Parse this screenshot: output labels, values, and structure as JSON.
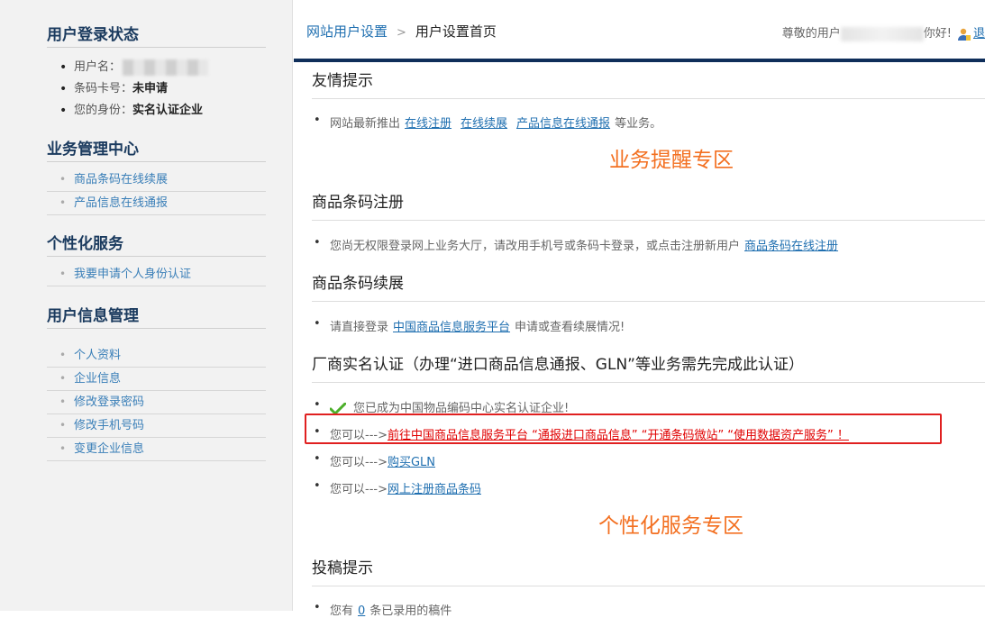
{
  "sidebar": {
    "login_status": {
      "title": "用户登录状态",
      "username_label": "用户名：",
      "barcode_label": "条码卡号：",
      "barcode_value": "未申请",
      "identity_label": "您的身份：",
      "identity_value": "实名认证企业"
    },
    "business": {
      "title": "业务管理中心",
      "items": [
        "商品条码在线续展",
        "产品信息在线通报"
      ]
    },
    "personal": {
      "title": "个性化服务",
      "items": [
        "我要申请个人身份认证"
      ]
    },
    "userinfo": {
      "title": "用户信息管理",
      "items": [
        "个人资料",
        "企业信息",
        "修改登录密码",
        "修改手机号码",
        "变更企业信息"
      ]
    }
  },
  "header": {
    "breadcrumb_root": "网站用户设置",
    "breadcrumb_sep": ">",
    "breadcrumb_current": "用户设置首页",
    "greeting_prefix": "尊敬的用户",
    "greeting_suffix": "你好!",
    "logout": "退"
  },
  "main": {
    "tips": {
      "title": "友情提示",
      "line_prefix": "网站最新推出",
      "link1": "在线注册",
      "link2": "在线续展",
      "link3": "产品信息在线通报",
      "line_suffix": "等业务。"
    },
    "reminder_zone": "业务提醒专区",
    "register": {
      "title": "商品条码注册",
      "line": "您尚无权限登录网上业务大厅，请改用手机号或条码卡登录，或点击注册新用户",
      "link": "商品条码在线注册"
    },
    "renewal": {
      "title": "商品条码续展",
      "prefix": "请直接登录",
      "link": "中国商品信息服务平台",
      "suffix": "申请或查看续展情况!"
    },
    "verification": {
      "title": "厂商实名认证（办理“进口商品信息通报、GLN”等业务需先完成此认证）",
      "done_text": "您已成为中国物品编码中心实名认证企业!",
      "can_prefix": "您可以--->",
      "link_platform": "前往中国商品信息服务平台 “通报进口商品信息” “开通条码微站” “使用数据资产服务” ！",
      "link_gln": "购买GLN",
      "link_register": "网上注册商品条码"
    },
    "personal_zone": "个性化服务专区",
    "submission": {
      "title": "投稿提示",
      "line_prefix": "您有",
      "count": "0",
      "line_suffix": "条已录用的稿件"
    }
  }
}
